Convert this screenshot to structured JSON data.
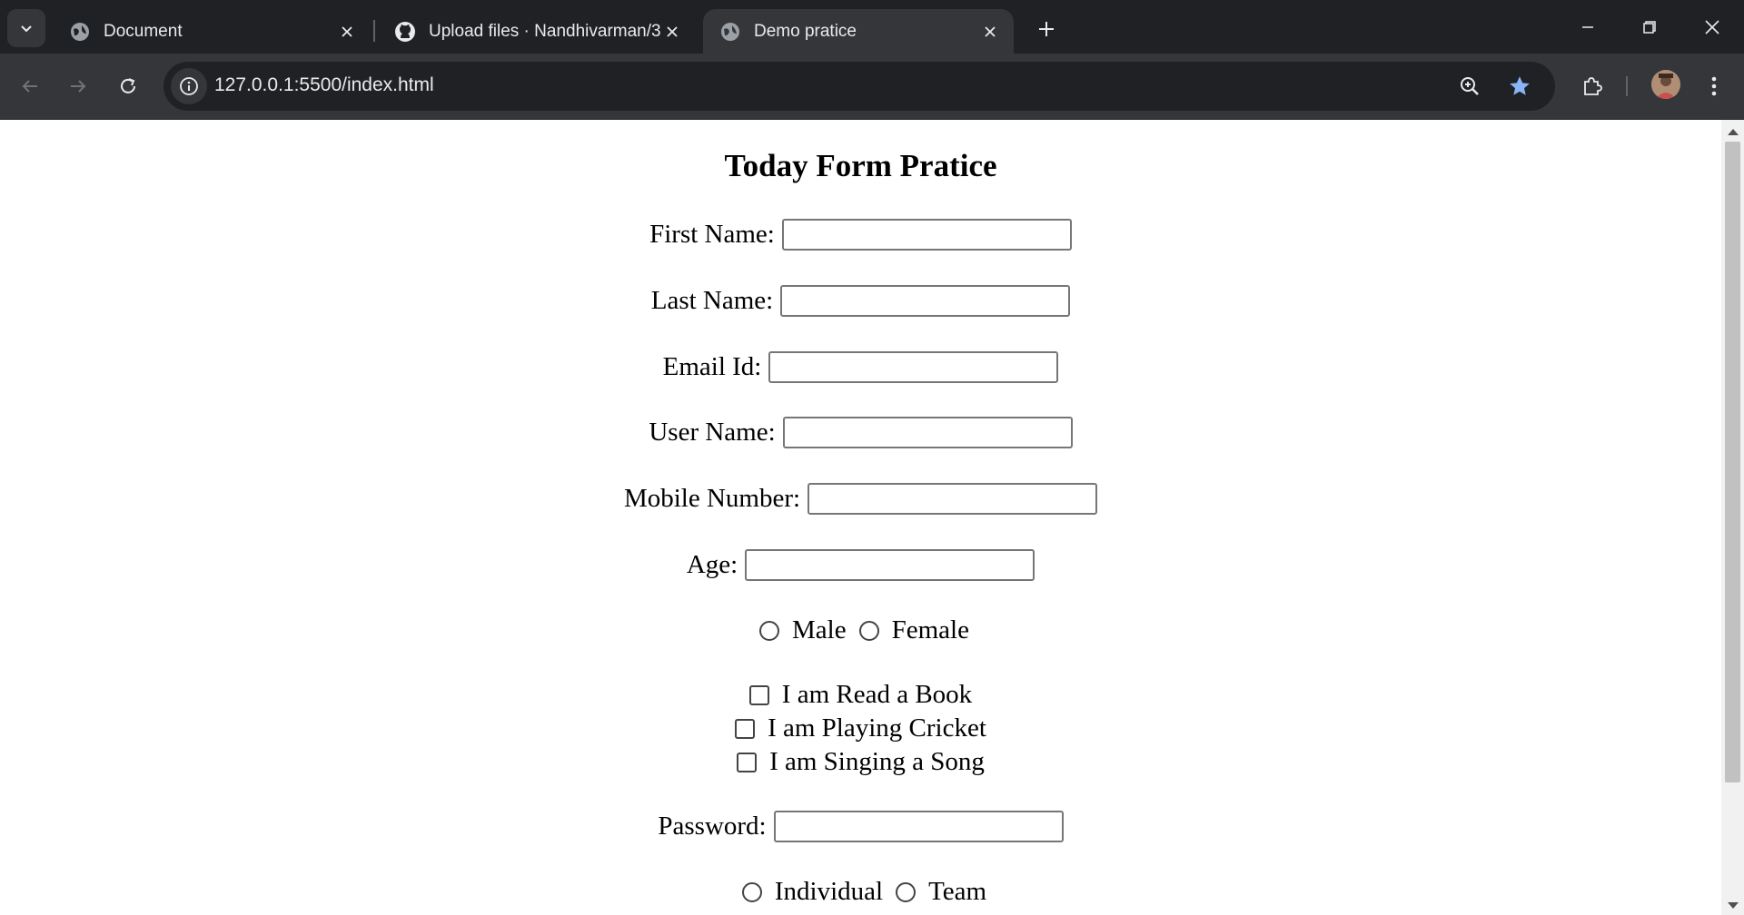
{
  "browser": {
    "tabs": [
      {
        "title": "Document",
        "favicon": "globe-icon",
        "active": false
      },
      {
        "title": "Upload files · Nandhivarman/3-",
        "favicon": "github-icon",
        "active": false
      },
      {
        "title": "Demo pratice",
        "favicon": "globe-icon",
        "active": true
      }
    ],
    "url": "127.0.0.1:5500/index.html"
  },
  "form": {
    "heading": "Today Form Pratice",
    "fields": {
      "first_name": {
        "label": "First Name:",
        "value": ""
      },
      "last_name": {
        "label": "Last Name:",
        "value": ""
      },
      "email": {
        "label": "Email Id:",
        "value": ""
      },
      "user_name": {
        "label": "User Name:",
        "value": ""
      },
      "mobile": {
        "label": "Mobile Number:",
        "value": ""
      },
      "age": {
        "label": "Age:",
        "value": ""
      },
      "password": {
        "label": "Password:",
        "value": ""
      }
    },
    "gender": {
      "options": [
        "Male",
        "Female"
      ]
    },
    "hobbies": [
      "I am Read a Book",
      "I am Playing Cricket",
      "I am Singing a Song"
    ],
    "participation": {
      "options": [
        "Individual",
        "Team"
      ]
    }
  },
  "colors": {
    "star_accent": "#8ab4f8",
    "chrome_dark": "#202124",
    "chrome_toolbar": "#35363a"
  }
}
